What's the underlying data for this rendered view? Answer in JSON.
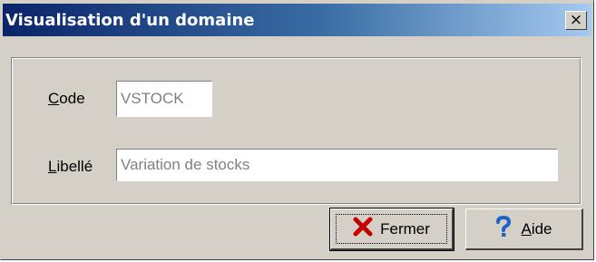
{
  "window": {
    "title": "Visualisation d'un domaine",
    "close_label": "×"
  },
  "form": {
    "code_label_mnemonic": "C",
    "code_label_rest": "ode",
    "code_value": "VSTOCK",
    "libelle_label_mnemonic": "L",
    "libelle_label_rest": "ibellé",
    "libelle_value": "Variation de stocks"
  },
  "buttons": {
    "fermer_label": "Fermer",
    "aide_mnemonic": "A",
    "aide_rest": "ide"
  },
  "colors": {
    "dialog_bg": "#d4d0c8",
    "title_gradient_start": "#0a246a",
    "title_gradient_end": "#a6caf0",
    "close_x_red": "#cc0000",
    "help_blue": "#1e63c8"
  },
  "icons": {
    "fermer": "red-x-icon",
    "aide": "question-mark-icon"
  }
}
